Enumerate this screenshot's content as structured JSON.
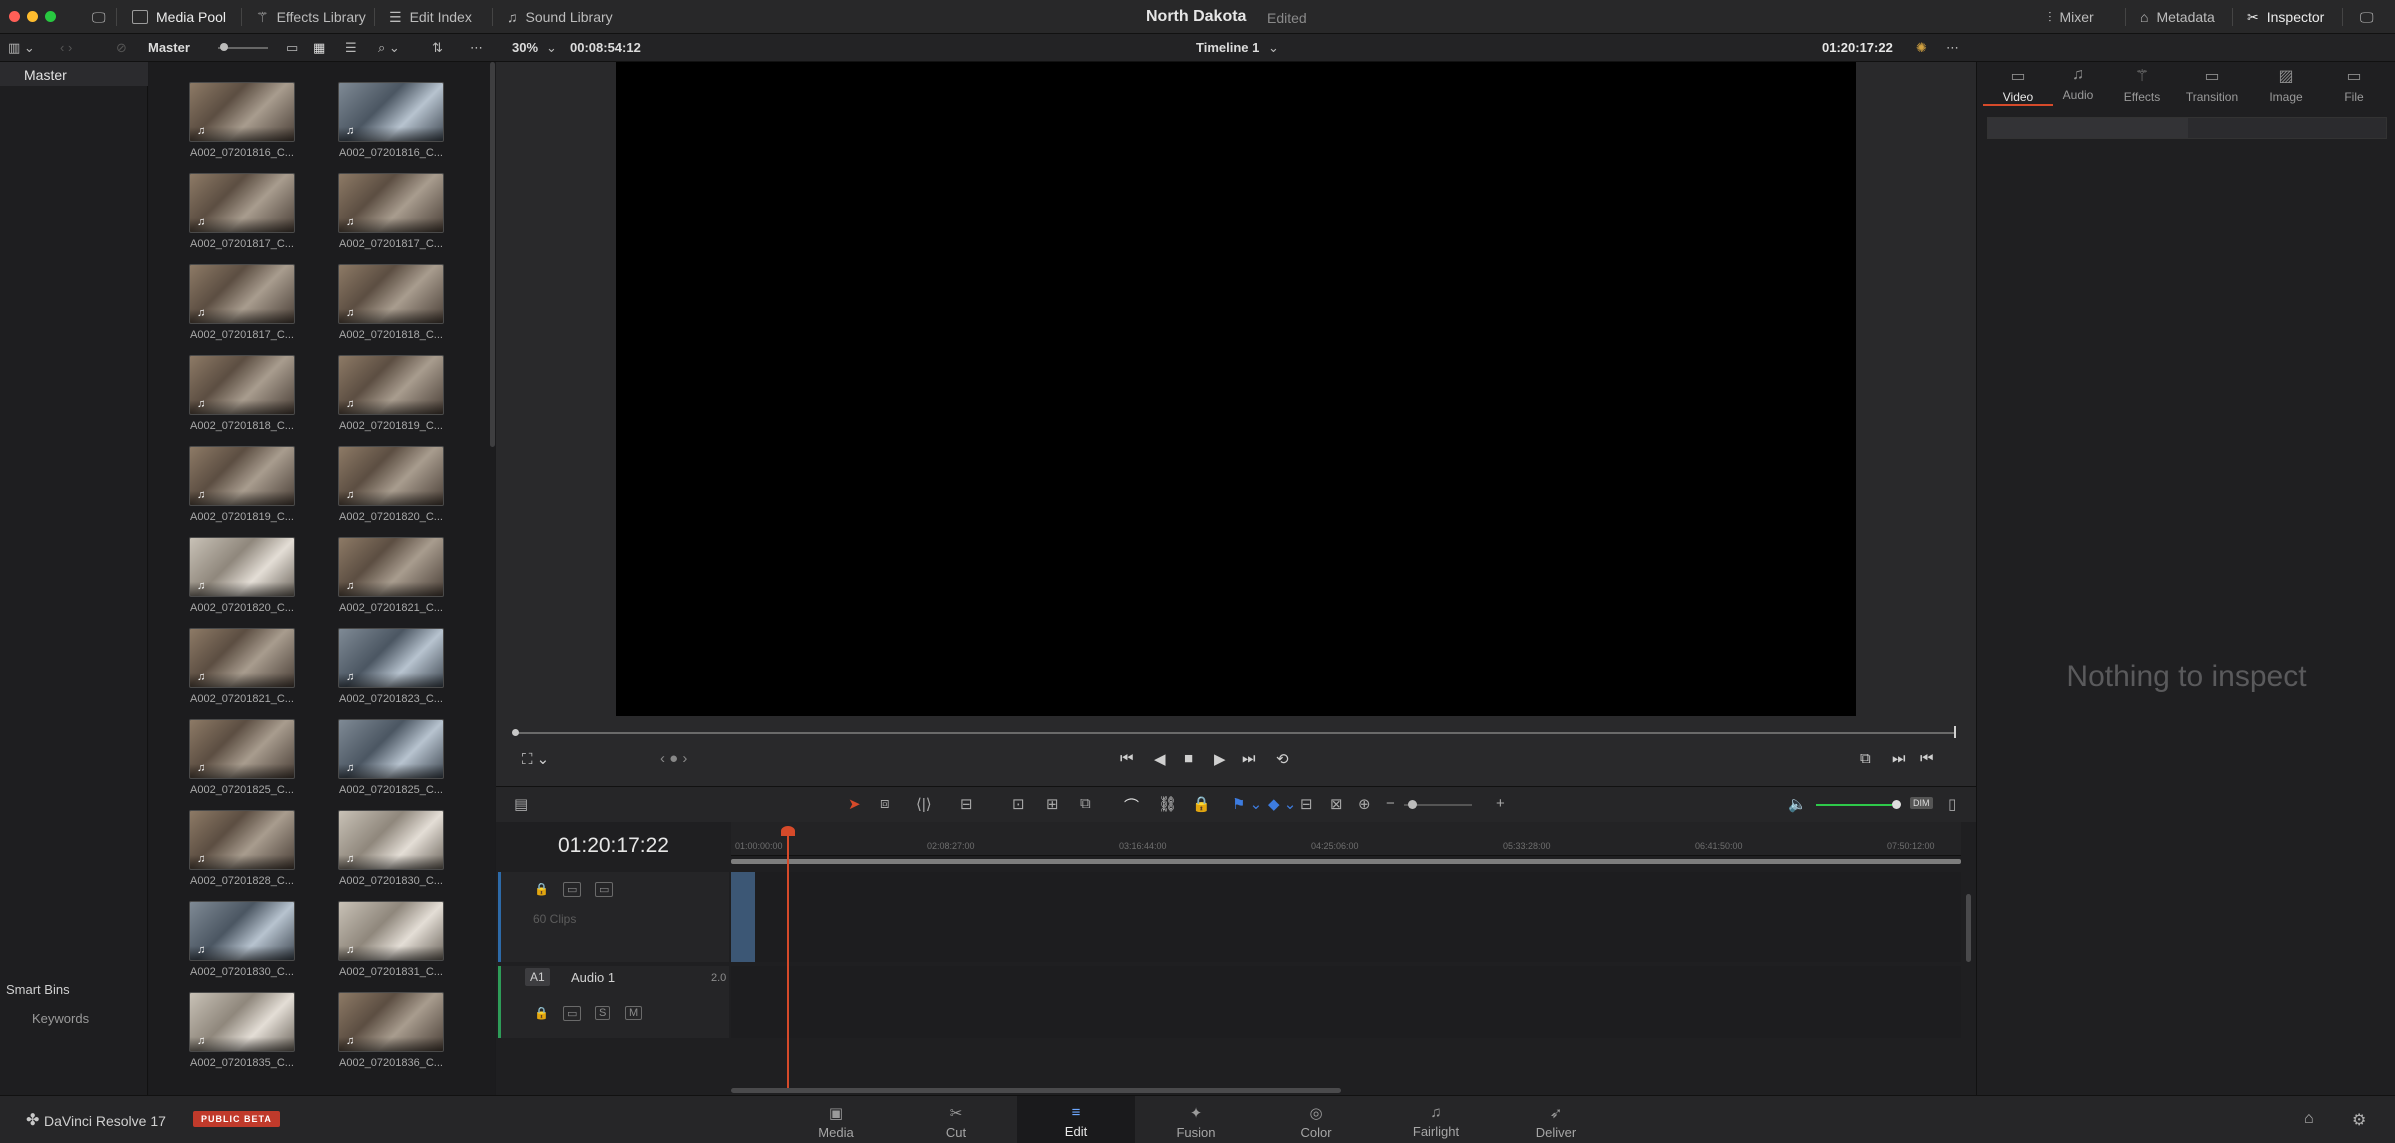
{
  "titlebar": {
    "media_pool": "Media Pool",
    "effects_library": "Effects Library",
    "edit_index": "Edit Index",
    "sound_library": "Sound Library",
    "project_title": "North Dakota",
    "project_status": "Edited",
    "mixer": "Mixer",
    "metadata": "Metadata",
    "inspector": "Inspector"
  },
  "subbar": {
    "bin_name": "Master",
    "zoom": "30%",
    "source_tc": "00:08:54:12",
    "timeline_name": "Timeline 1",
    "record_tc": "01:20:17:22"
  },
  "bins": {
    "master": "Master",
    "smart_bins": "Smart Bins",
    "keywords": "Keywords"
  },
  "clips": [
    {
      "name": "A002_07201816_C..."
    },
    {
      "name": "A002_07201816_C..."
    },
    {
      "name": "A002_07201817_C..."
    },
    {
      "name": "A002_07201817_C..."
    },
    {
      "name": "A002_07201817_C..."
    },
    {
      "name": "A002_07201818_C..."
    },
    {
      "name": "A002_07201818_C..."
    },
    {
      "name": "A002_07201819_C..."
    },
    {
      "name": "A002_07201819_C..."
    },
    {
      "name": "A002_07201820_C..."
    },
    {
      "name": "A002_07201820_C..."
    },
    {
      "name": "A002_07201821_C..."
    },
    {
      "name": "A002_07201821_C..."
    },
    {
      "name": "A002_07201823_C..."
    },
    {
      "name": "A002_07201825_C..."
    },
    {
      "name": "A002_07201825_C..."
    },
    {
      "name": "A002_07201828_C..."
    },
    {
      "name": "A002_07201830_C..."
    },
    {
      "name": "A002_07201830_C..."
    },
    {
      "name": "A002_07201831_C..."
    },
    {
      "name": "A002_07201835_C..."
    },
    {
      "name": "A002_07201836_C..."
    }
  ],
  "timeline": {
    "timecode": "01:20:17:22",
    "ruler_ticks": [
      "01:00:00:00",
      "02:08:27:00",
      "03:16:44:00",
      "04:25:06:00",
      "05:33:28:00",
      "06:41:50:00",
      "07:50:12:00"
    ],
    "video_track_info": "60 Clips",
    "audio_track_tag": "A1",
    "audio_track_name": "Audio 1",
    "audio_channels": "2.0",
    "solo": "S",
    "mute": "M",
    "dim": "DIM"
  },
  "inspector": {
    "tabs": [
      "Video",
      "Audio",
      "Effects",
      "Transition",
      "Image",
      "File"
    ],
    "empty_message": "Nothing to inspect"
  },
  "footer": {
    "brand": "DaVinci Resolve 17",
    "beta": "PUBLIC BETA",
    "pages": [
      "Media",
      "Cut",
      "Edit",
      "Fusion",
      "Color",
      "Fairlight",
      "Deliver"
    ]
  },
  "colors": {
    "accent": "#d64a2a",
    "video_track": "#2d6aa8",
    "audio_track": "#2e9c58",
    "beta_badge": "#c03a2b"
  }
}
